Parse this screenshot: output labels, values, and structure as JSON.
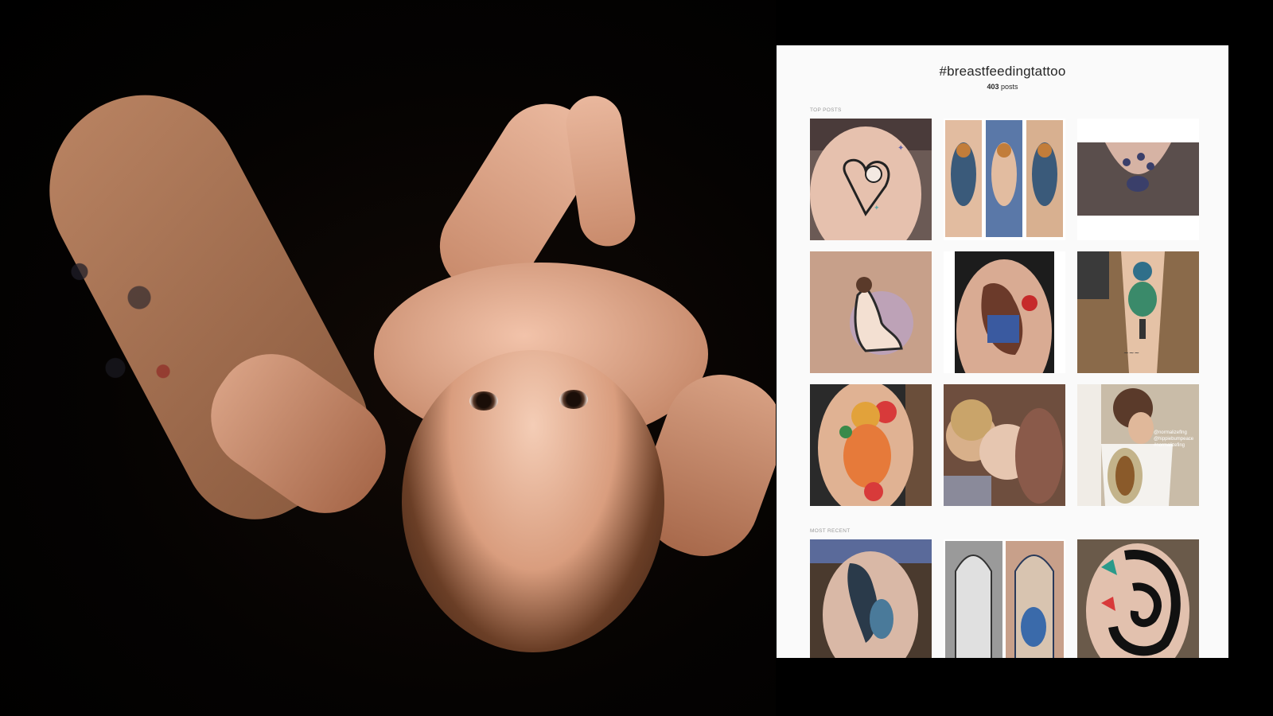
{
  "photo": {
    "subject_icon": "baby-photo"
  },
  "panel": {
    "hashtag": "#breastfeedingtattoo",
    "post_count": "403",
    "post_count_suffix": " posts",
    "top_posts_label": "TOP POSTS",
    "most_recent_label": "MOST RECENT",
    "overlay_handles": [
      "@normalizeflng",
      "@hippiebumpeace",
      "#normalizefing"
    ]
  },
  "colors": {
    "panel_bg": "#fafafa",
    "page_bg": "#000000",
    "title_text": "#262626",
    "label_text": "#999999"
  }
}
